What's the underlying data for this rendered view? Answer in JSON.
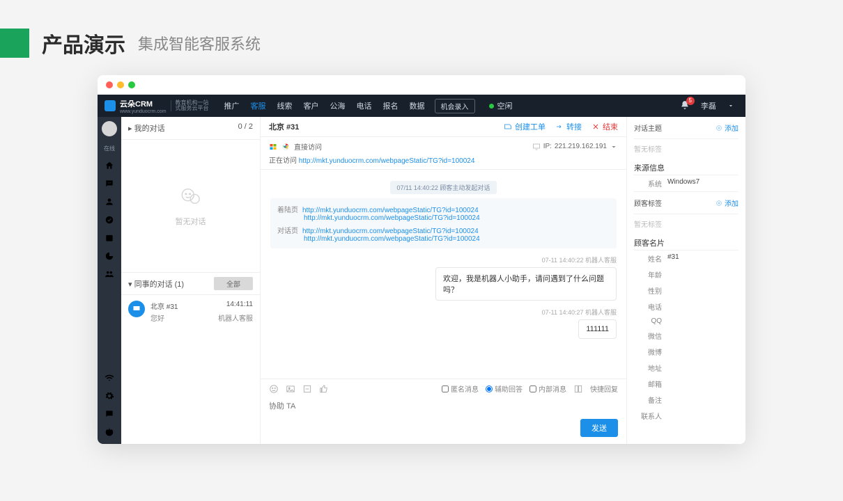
{
  "slide": {
    "title": "产品演示",
    "subtitle": "集成智能客服系统"
  },
  "brand": {
    "name": "云朵CRM",
    "sub1": "教育机构一站",
    "sub2": "式服务云平台",
    "url": "www.yunduocrm.com"
  },
  "nav": {
    "items": [
      "推广",
      "客服",
      "线索",
      "客户",
      "公海",
      "电话",
      "报名",
      "数据"
    ],
    "activeIndex": 1,
    "record_btn": "机会录入",
    "status": "空闲",
    "user": "李磊",
    "notif_count": "5"
  },
  "rail": {
    "online": "在线"
  },
  "convs": {
    "mine_label": "我的对话",
    "mine_count": "0 / 2",
    "empty": "暂无对话",
    "peers_label": "同事的对话  (1)",
    "all_btn": "全部",
    "peer": {
      "name": "北京 #31",
      "msg": "您好",
      "time": "14:41:11",
      "role": "机器人客服"
    }
  },
  "chat": {
    "title": "北京 #31",
    "actions": {
      "ticket": "创建工单",
      "transfer": "转接",
      "end": "结束"
    },
    "meta": {
      "access": "直接访问",
      "ip_label": "IP:",
      "ip": "221.219.162.191",
      "visiting_label": "正在访问",
      "visiting_url": "http://mkt.yunduocrm.com/webpageStatic/TG?id=100024"
    },
    "log": {
      "start_ts": "07/11 14:40:22  顾客主动发起对话",
      "landing_label": "着陆页",
      "dialog_label": "对话页",
      "url1": "http://mkt.yunduocrm.com/webpageStatic/TG?id=100024",
      "url2": "http://mkt.yunduocrm.com/webpageStatic/TG?id=100024",
      "url3": "http://mkt.yunduocrm.com/webpageStatic/TG?id=100024",
      "url4": "http://mkt.yunduocrm.com/webpageStatic/TG?id=100024",
      "ts2": "07-11 14:40:22  机器人客服",
      "bot_msg": "欢迎，我是机器人小助手，请问遇到了什么问题吗？",
      "ts3": "07-11 14:40:27  机器人客服",
      "bot_msg2": "111111"
    },
    "tools": {
      "anon": "匿名消息",
      "assist": "辅助回答",
      "internal": "内部消息",
      "quick": "快捷回复",
      "placeholder": "协助 TA",
      "send": "发送"
    }
  },
  "info": {
    "topic_label": "对话主题",
    "add": "添加",
    "none": "暂无标签",
    "source_label": "来源信息",
    "system_k": "系统",
    "system_v": "Windows7",
    "tags_label": "顾客标签",
    "tags_none": "暂无标签",
    "card_label": "顾客名片",
    "fields": {
      "name_k": "姓名",
      "name_v": "#31",
      "age": "年龄",
      "gender": "性别",
      "phone": "电话",
      "qq": "QQ",
      "wechat": "微信",
      "weibo": "微博",
      "addr": "地址",
      "email": "邮箱",
      "remark": "备注",
      "contact": "联系人"
    }
  }
}
